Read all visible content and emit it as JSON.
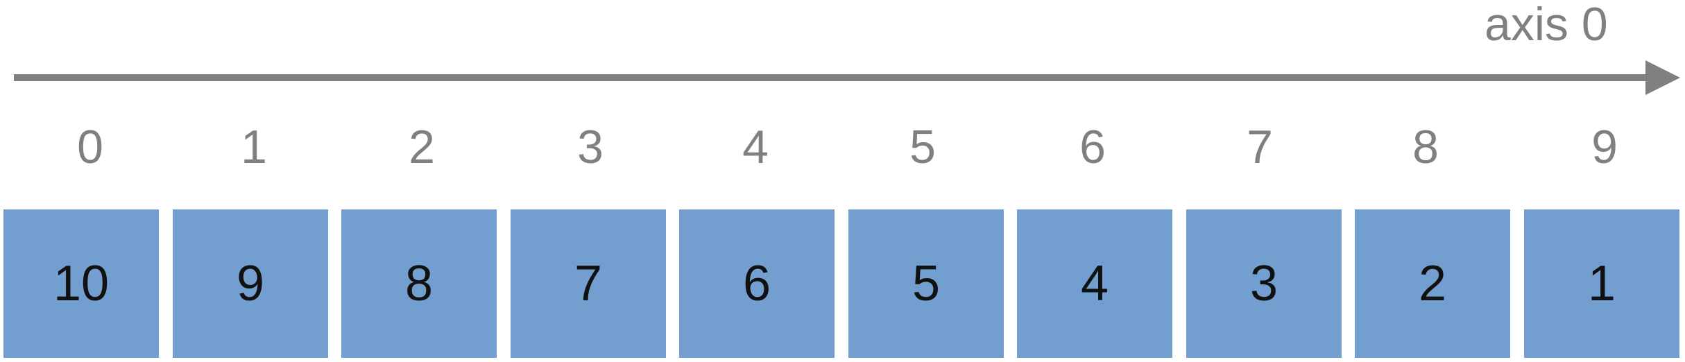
{
  "axis": {
    "label": "axis 0",
    "color": "#808080"
  },
  "array": {
    "indices": [
      "0",
      "1",
      "2",
      "3",
      "4",
      "5",
      "6",
      "7",
      "8",
      "9"
    ],
    "values": [
      "10",
      "9",
      "8",
      "7",
      "6",
      "5",
      "4",
      "3",
      "2",
      "1"
    ],
    "cell_color": "#729fcf",
    "text_color": "#111111"
  }
}
